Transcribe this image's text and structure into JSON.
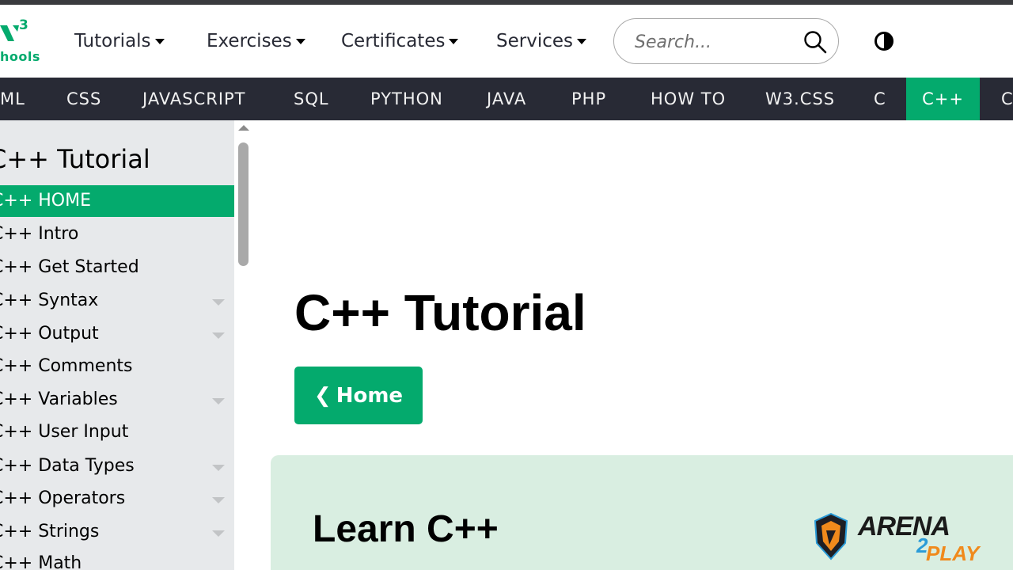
{
  "logo": {
    "superscript": "3",
    "wordmark": "hools"
  },
  "header": {
    "menus": [
      {
        "label": "Tutorials"
      },
      {
        "label": "Exercises"
      },
      {
        "label": "Certificates"
      },
      {
        "label": "Services"
      }
    ],
    "search": {
      "placeholder": "Search...",
      "icon": "search-icon"
    },
    "theme_toggle_icon": "contrast-icon"
  },
  "topnav": {
    "items": [
      "ML",
      "CSS",
      "JAVASCRIPT",
      "SQL",
      "PYTHON",
      "JAVA",
      "PHP",
      "HOW TO",
      "W3.CSS",
      "C",
      "C++",
      "C"
    ],
    "active": "C++"
  },
  "sidebar": {
    "title": "C++ Tutorial",
    "items": [
      {
        "label": "C++ HOME",
        "active": true,
        "dropdown": false
      },
      {
        "label": "C++ Intro",
        "dropdown": false
      },
      {
        "label": "C++ Get Started",
        "dropdown": false
      },
      {
        "label": "C++ Syntax",
        "dropdown": true
      },
      {
        "label": "C++ Output",
        "dropdown": true
      },
      {
        "label": "C++ Comments",
        "dropdown": false
      },
      {
        "label": "C++ Variables",
        "dropdown": true
      },
      {
        "label": "C++ User Input",
        "dropdown": false
      },
      {
        "label": "C++ Data Types",
        "dropdown": true
      },
      {
        "label": "C++ Operators",
        "dropdown": true
      },
      {
        "label": "C++ Strings",
        "dropdown": true
      },
      {
        "label": "C++ Math",
        "dropdown": false
      }
    ]
  },
  "main": {
    "title": "C++ Tutorial",
    "home_button": {
      "chevron": "❮",
      "label": "Home"
    },
    "learn_heading": "Learn C++"
  },
  "watermark": {
    "word1": "ARENA",
    "digit": "2",
    "word2": "PLAY"
  },
  "colors": {
    "accent": "#04aa6d",
    "topnav_bg": "#282a35",
    "sidebar_bg": "#e7e9eb",
    "panel_bg": "#d9eee1"
  }
}
